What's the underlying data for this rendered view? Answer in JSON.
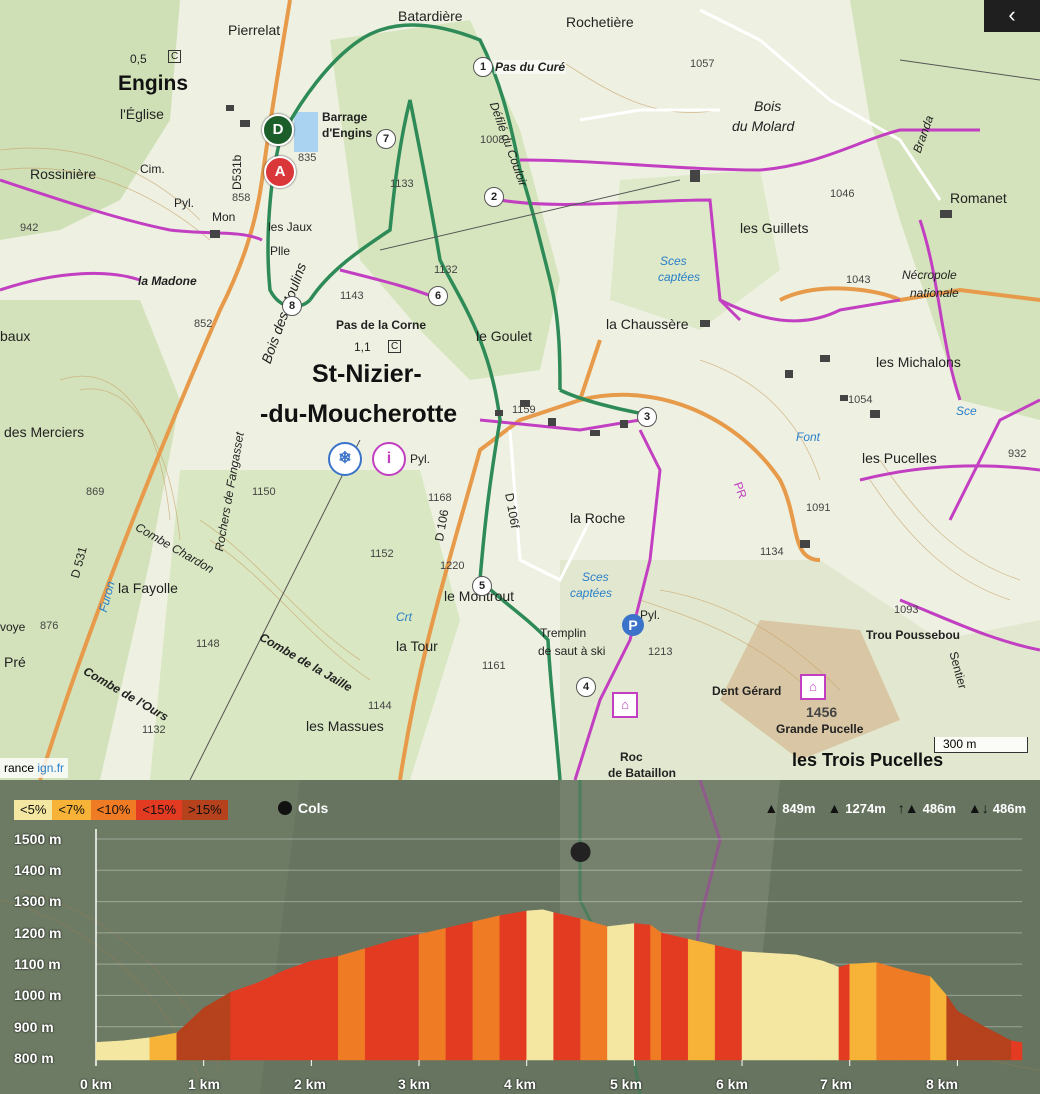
{
  "ui": {
    "back_button": "‹",
    "scale_label": "300 m",
    "attribution_prefix": "rance ",
    "attribution_link": "ign.fr"
  },
  "map": {
    "markers": {
      "start": "D",
      "finish": "A"
    },
    "waypoints": [
      "1",
      "2",
      "3",
      "4",
      "5",
      "6",
      "7",
      "8"
    ],
    "places": {
      "engins": "Engins",
      "pierrelat": "Pierrelat",
      "batardiere": "Batardière",
      "rochetiere": "Rochetière",
      "pas_du_cure": "Pas du Curé",
      "defile_du_couloir": "Défilé du Couloir",
      "barrage_engins_1": "Barrage",
      "barrage_engins_2": "d'Engins",
      "eglise": "l'Église",
      "rossiniere": "Rossinière",
      "cim": "Cim.",
      "pyl": "Pyl.",
      "mon": "Mon",
      "les_jaux": "les Jaux",
      "plle": "Plle",
      "la_madone": "la Madone",
      "baux": "baux",
      "bois_des_moulins": "Bois des Moulins",
      "pas_de_la_corne": "Pas de la Corne",
      "le_goulet": "le Goulet",
      "la_chaussere": "la Chaussère",
      "bois_du_molard_1": "Bois",
      "bois_du_molard_2": "du Molard",
      "les_guillets": "les Guillets",
      "romanet": "Romanet",
      "branda": "Branda",
      "necropole_1": "Nécropole",
      "necropole_2": "nationale",
      "sces_captees_1": "Sces",
      "sces_captees_2": "captées",
      "les_michalons": "les Michalons",
      "st_nizier_1": "St-Nizier-",
      "st_nizier_2": "-du-Moucherotte",
      "des_merciers": "des Merciers",
      "rochers_de_fangasset": "Rochers de Fangasset",
      "font": "Font",
      "sce": "Sce",
      "les_pucelles": "les Pucelles",
      "la_roche": "la Roche",
      "d106": "D 106",
      "d106f": "D 106f",
      "d531": "D 531",
      "d531b": "D531b",
      "combe_chardon": "Combe Chardon",
      "furon": "Furon",
      "la_fayolle": "la Fayolle",
      "le_montrout": "le Montrout",
      "crt": "Crt",
      "la_tour": "la Tour",
      "tremplin_1": "Tremplin",
      "tremplin_2": "de saut à ski",
      "combe_de_la_jaille": "Combe de la Jaille",
      "combe_de_l_ours": "Combe de l'Ours",
      "les_massues": "les Massues",
      "roc_de_bataillon_1": "Roc",
      "roc_de_bataillon_2": "de Bataillon",
      "dent_gerard": "Dent Gérard",
      "grande_pucelle": "Grande Pucelle",
      "les_trois_pucelles": "les Trois Pucelles",
      "trou_poussebou": "Trou Poussebou",
      "sentier": "Sentier",
      "pr": "PR",
      "pre": "Pré",
      "voye": "voye",
      "c_mark": "C",
      "scale_05": "0,5",
      "scale_11": "1,1"
    },
    "altitudes": [
      "1057",
      "1008",
      "1046",
      "1043",
      "835",
      "858",
      "942",
      "852",
      "1133",
      "1132",
      "1143",
      "1054",
      "1159",
      "869",
      "1150",
      "1168",
      "1152",
      "1220",
      "1213",
      "1161",
      "1148",
      "1144",
      "1132",
      "1091",
      "1134",
      "1456",
      "1043",
      "932",
      "876",
      "1093"
    ]
  },
  "profile": {
    "legend": [
      {
        "label": "<5%",
        "color": "#f4e7a1"
      },
      {
        "label": "<7%",
        "color": "#f6b338"
      },
      {
        "label": "<10%",
        "color": "#ef7b25"
      },
      {
        "label": "<15%",
        "color": "#e33b22"
      },
      {
        "label": ">15%",
        "color": "#b5421d"
      }
    ],
    "cols_label": "Cols",
    "stats": [
      {
        "icon": "min-altitude-icon",
        "glyph": "▲",
        "value": "849m"
      },
      {
        "icon": "max-altitude-icon",
        "glyph": "▲",
        "value": "1274m"
      },
      {
        "icon": "ascent-icon",
        "glyph": "↑▲",
        "value": "486m"
      },
      {
        "icon": "descent-icon",
        "glyph": "▲↓",
        "value": "486m"
      }
    ]
  },
  "chart_data": {
    "type": "area",
    "title": "",
    "xlabel": "",
    "ylabel": "",
    "x_unit": "km",
    "y_unit": "m",
    "xlim": [
      0,
      8.6
    ],
    "ylim": [
      800,
      1500
    ],
    "x_ticks": [
      "0 km",
      "1 km",
      "2 km",
      "3 km",
      "4 km",
      "5 km",
      "6 km",
      "7 km",
      "8 km"
    ],
    "y_ticks": [
      "800 m",
      "900 m",
      "1000 m",
      "1100 m",
      "1200 m",
      "1300 m",
      "1400 m",
      "1500 m"
    ],
    "x": [
      0,
      0.25,
      0.5,
      0.75,
      1.0,
      1.25,
      1.5,
      1.75,
      2.0,
      2.25,
      2.5,
      2.75,
      3.0,
      3.25,
      3.5,
      3.75,
      4.0,
      4.15,
      4.25,
      4.5,
      4.75,
      5.0,
      5.15,
      5.25,
      5.5,
      5.75,
      6.0,
      6.25,
      6.5,
      6.75,
      6.9,
      7.0,
      7.25,
      7.5,
      7.75,
      7.9,
      8.0,
      8.25,
      8.5,
      8.6
    ],
    "y": [
      850,
      855,
      865,
      880,
      960,
      1010,
      1040,
      1080,
      1110,
      1125,
      1150,
      1175,
      1195,
      1215,
      1235,
      1255,
      1270,
      1274,
      1265,
      1245,
      1220,
      1230,
      1225,
      1200,
      1180,
      1160,
      1140,
      1135,
      1130,
      1110,
      1090,
      1100,
      1105,
      1080,
      1060,
      1000,
      950,
      900,
      855,
      849
    ],
    "gradient_class": [
      0,
      0,
      1,
      4,
      4,
      3,
      3,
      3,
      3,
      2,
      3,
      3,
      2,
      3,
      2,
      3,
      0,
      0,
      3,
      2,
      0,
      3,
      2,
      3,
      1,
      3,
      0,
      0,
      0,
      0,
      3,
      1,
      2,
      2,
      1,
      4,
      4,
      4,
      3,
      0
    ],
    "cols": [
      {
        "x": 4.5,
        "label": "5"
      }
    ]
  }
}
